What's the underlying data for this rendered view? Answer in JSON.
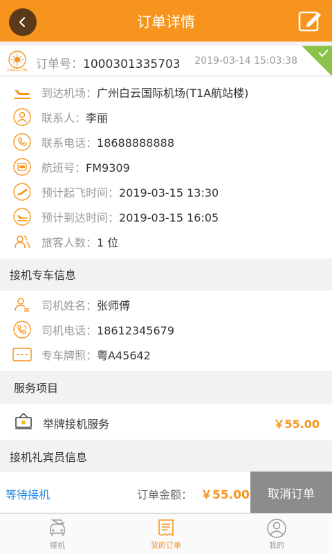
{
  "header": {
    "title": "订单详情"
  },
  "order": {
    "no_label": "订单号：",
    "no_value": "1000301335703",
    "time": "2019-03-14 15:03:38"
  },
  "info": {
    "airport_label": "到达机场：",
    "airport_value": "广州白云国际机场(T1A航站楼)",
    "contact_label": "联系人：",
    "contact_value": "李丽",
    "phone_label": "联系电话：",
    "phone_value": "18688888888",
    "flight_label": "航班号：",
    "flight_value": "FM9309",
    "depart_label": "预计起飞时间：",
    "depart_value": "2019-03-15 13:30",
    "arrive_label": "预计到达时间：",
    "arrive_value": "2019-03-15 16:05",
    "passengers_label": "旅客人数：",
    "passengers_value": "1 位"
  },
  "driver_section": {
    "title": "接机专车信息",
    "name_label": "司机姓名：",
    "name_value": "张师傅",
    "phone_label": "司机电话：",
    "phone_value": "18612345679",
    "plate_label": "专车牌照：",
    "plate_value": "粤A45642"
  },
  "service_section": {
    "title": "服务项目",
    "item_name": "举牌接机服务",
    "item_price": "￥55.00"
  },
  "vip_section": {
    "title": "接机礼宾员信息"
  },
  "bottom": {
    "status": "等待接机",
    "amount_label": "订单金额：",
    "amount_value": "￥55.00",
    "cancel_label": "取消订单"
  },
  "tabs": [
    {
      "label": "接机"
    },
    {
      "label": "我的订单"
    },
    {
      "label": "我的"
    }
  ],
  "colors": {
    "accent": "#f7941d",
    "status_blue": "#1e88e5",
    "cancel_gray": "#8c8c8c"
  }
}
